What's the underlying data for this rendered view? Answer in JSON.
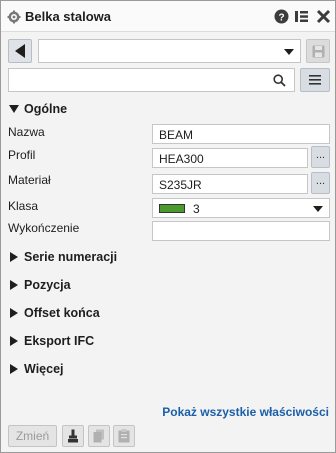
{
  "titlebar": {
    "title": "Belka stalowa"
  },
  "toolbar": {
    "preset_value": "",
    "search_value": ""
  },
  "sections": {
    "general": "Ogólne",
    "numbering": "Serie numeracji",
    "position": "Pozycja",
    "end_offset": "Offset końca",
    "ifc_export": "Eksport IFC",
    "more": "Więcej"
  },
  "properties": {
    "name": {
      "label": "Nazwa",
      "value": "BEAM"
    },
    "profile": {
      "label": "Profil",
      "value": "HEA300",
      "button": "..."
    },
    "material": {
      "label": "Materiał",
      "value": "S235JR",
      "button": "..."
    },
    "class": {
      "label": "Klasa",
      "value": "3",
      "color": "#4a9a2e"
    },
    "finish": {
      "label": "Wykończenie",
      "value": ""
    }
  },
  "footer": {
    "show_all": "Pokaż wszystkie właściwości",
    "modify": "Zmień"
  },
  "colors": {
    "accent_link": "#1a5fa8",
    "class_color": "#4a9a2e"
  }
}
